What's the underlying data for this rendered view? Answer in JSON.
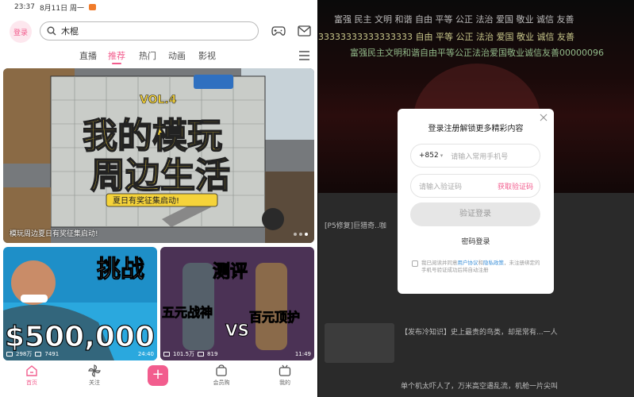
{
  "status": {
    "time": "23:37",
    "date": "8月11日 周一"
  },
  "topbar": {
    "login_label": "登录",
    "search_value": "木棍"
  },
  "tabs": [
    {
      "label": "直播"
    },
    {
      "label": "推荐"
    },
    {
      "label": "热门"
    },
    {
      "label": "动画"
    },
    {
      "label": "影视"
    }
  ],
  "banner": {
    "art_line1": "我的模玩",
    "art_line2": "周边生活",
    "art_vol": "VOL.4",
    "art_sub": "夏日有奖征集启动!",
    "caption": "模玩周边夏日有奖征集启动!"
  },
  "cards": [
    {
      "art_title": "挑战",
      "art_big": "$500,000",
      "views": "298万",
      "danmaku": "7491",
      "duration": "24:40"
    },
    {
      "art_title": "测评",
      "art_left": "五元战神",
      "art_vs": "VS",
      "art_right": "百元顶护",
      "views": "101.5万",
      "danmaku": "819",
      "duration": "11:49"
    }
  ],
  "bottom_nav": [
    {
      "label": "首页"
    },
    {
      "label": "关注"
    },
    {
      "label": "会员购"
    },
    {
      "label": "我的"
    }
  ],
  "plus_label": "+",
  "modal": {
    "title": "登录注册解锁更多精彩内容",
    "country_code": "+852",
    "phone_placeholder": "请输入常用手机号",
    "code_placeholder": "请输入验证码",
    "get_code": "获取验证码",
    "verify_button": "验证登录",
    "password_login": "密码登录",
    "agree_prefix": "我已阅读并同意",
    "agree_link1": "用户协议",
    "agree_and": "和",
    "agree_link2": "隐私政策",
    "agree_suffix": "，未注册绑定的手机号验证成功后将自动注册"
  },
  "danmaku": [
    "富强 民主 文明 和谐 自由 平等 公正 法治 爱国 敬业 诚信 友善",
    "33333333333333333 自由 平等 公正 法治 爱国 敬业 诚信 友善",
    "富强民主文明和谐自由平等公正法治爱国敬业诚信友善00000096"
  ],
  "behind": {
    "title1": "[P5修复]巨猎奇..咖",
    "title2": "【发布冷知识】史上最贵的鸟类，却是常有...一人",
    "title3": "单个机太吓人了，万米高空遇乱流，机舱一片尖叫"
  },
  "colors": {
    "accent": "#f25d8e"
  }
}
